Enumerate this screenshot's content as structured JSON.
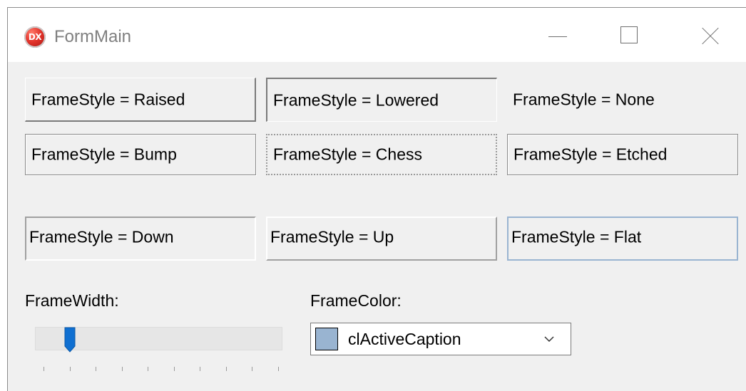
{
  "window": {
    "title": "FormMain",
    "icon_text": "DX",
    "controls": {
      "minimize": "minimize-icon",
      "maximize": "maximize-icon",
      "close": "close-icon"
    }
  },
  "panels": [
    {
      "style": "raised",
      "label": "FrameStyle = Raised"
    },
    {
      "style": "lowered",
      "label": "FrameStyle = Lowered"
    },
    {
      "style": "none",
      "label": "FrameStyle = None"
    },
    {
      "style": "bump",
      "label": "FrameStyle = Bump"
    },
    {
      "style": "chess",
      "label": "FrameStyle = Chess"
    },
    {
      "style": "etched",
      "label": "FrameStyle = Etched"
    },
    {
      "style": "down",
      "label": "FrameStyle = Down"
    },
    {
      "style": "up",
      "label": "FrameStyle = Up"
    },
    {
      "style": "flat",
      "label": "FrameStyle = Flat",
      "frame_color": "#99b4d1"
    }
  ],
  "frame_width": {
    "label": "FrameWidth:",
    "position": 1,
    "tick_count": 10,
    "thumb_color": "#0f6fd1"
  },
  "frame_color": {
    "label": "FrameColor:",
    "selected": "clActiveCaption",
    "swatch_color": "#99b4d1"
  }
}
